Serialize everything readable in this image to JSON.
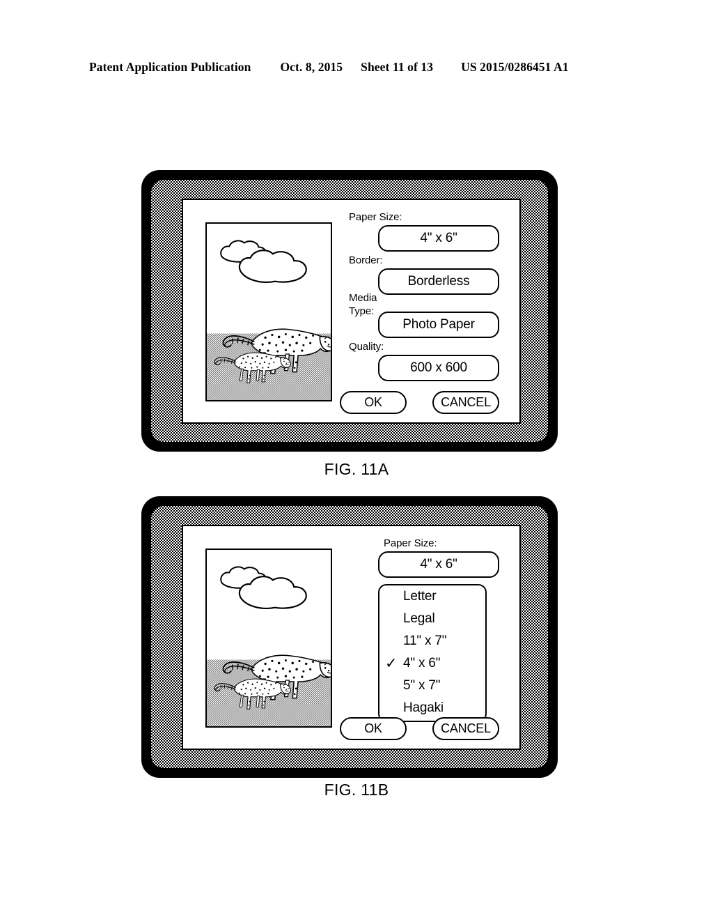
{
  "header": {
    "publication": "Patent Application Publication",
    "date": "Oct. 8, 2015",
    "sheet": "Sheet 11 of 13",
    "patent_number": "US 2015/0286451 A1"
  },
  "figures": [
    {
      "caption": "FIG. 11A",
      "dialog": {
        "fields": [
          {
            "label": "Paper Size:",
            "value": "4\" x 6\""
          },
          {
            "label": "Border:",
            "value": "Borderless"
          },
          {
            "label_line1": "Media",
            "label_line2": "Type:",
            "value": "Photo Paper"
          },
          {
            "label": "Quality:",
            "value": "600 x 600"
          }
        ],
        "buttons": {
          "ok": "OK",
          "cancel": "CANCEL"
        }
      }
    },
    {
      "caption": "FIG. 11B",
      "dialog": {
        "fields": [
          {
            "label": "Paper Size:",
            "value": "4\" x 6\""
          }
        ],
        "dropdown": {
          "options": [
            {
              "label": "Letter",
              "checked": false
            },
            {
              "label": "Legal",
              "checked": false
            },
            {
              "label": "11\" x 7\"",
              "checked": false
            },
            {
              "label": "4\" x 6\"",
              "checked": true
            },
            {
              "label": "5\" x 7\"",
              "checked": false
            },
            {
              "label": "Hagaki",
              "checked": false
            }
          ],
          "check_glyph": "✓"
        },
        "buttons": {
          "ok": "OK",
          "cancel": "CANCEL"
        }
      }
    }
  ],
  "preview_image": {
    "description": "two cheetahs on ground with clouds in sky",
    "sky_color": "#ffffff",
    "ground_color": "#c9c9c9",
    "line_color": "#000000"
  }
}
